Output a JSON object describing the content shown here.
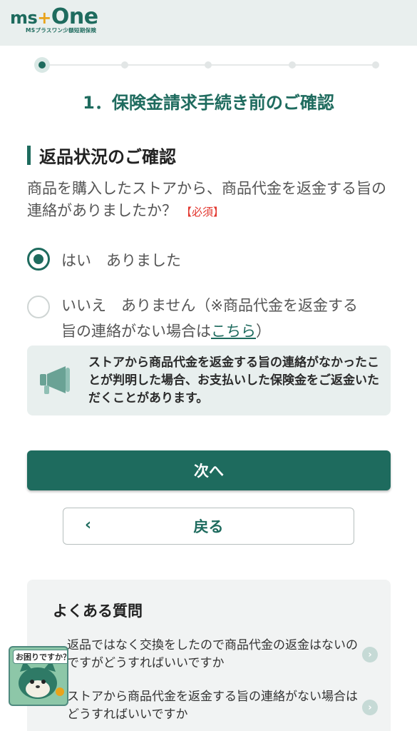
{
  "header": {
    "logo_main_ms": "ms",
    "logo_main_plus": "+",
    "logo_main_one": "One",
    "logo_sub": "MSプラスワン少額短期保険"
  },
  "stepper": {
    "total": 5,
    "current": 1
  },
  "page_title": "1．保険金請求手続き前のご確認",
  "section": {
    "title": "返品状況のご確認",
    "question": "商品を購入したストアから、商品代金を返金する旨の連絡がありましたか？",
    "required_label": "【必須】"
  },
  "options": [
    {
      "label": "はい　ありました",
      "checked": true
    },
    {
      "label_before_link": "いいえ　ありません（※商品代金を返金する旨の連絡がない場合は",
      "link_text": "こちら",
      "label_after_link": "）",
      "checked": false
    }
  ],
  "notice": {
    "icon": "megaphone-icon",
    "text": "ストアから商品代金を返金する旨の連絡がなかったことが判明した場合、お支払いした保険金をご返金いただくことがあります。"
  },
  "buttons": {
    "next": "次へ",
    "back": "戻る"
  },
  "faq": {
    "title": "よくある質問",
    "items": [
      "返品ではなく交換をしたので商品代金の返金はないのですがどうすればいいですか",
      "ストアから商品代金を返金する旨の連絡がない場合はどうすればいいですか"
    ]
  },
  "help_widget": {
    "label": "お困りですか？"
  },
  "colors": {
    "brand": "#1e6b5e",
    "accent": "#e9a31b",
    "required": "#e2352d"
  }
}
